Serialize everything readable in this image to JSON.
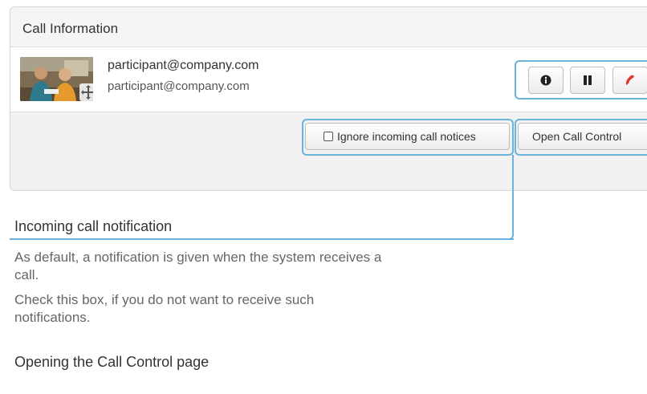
{
  "call_panel": {
    "title": "Call Information",
    "close_label": "×",
    "remote_name": "participant@company.com",
    "remote_number": "participant@company.com",
    "buttons": {
      "info_icon": "info-icon",
      "hold_icon": "pause-icon",
      "end_icon": "hang-up-icon"
    },
    "ignore_checkbox_label": "Ignore incoming call notices",
    "open_call_control_label": "Open Call Control"
  },
  "help": {
    "incoming_heading": "Incoming call notification",
    "incoming_para1": "As default, a notification is given when the system receives a call.",
    "incoming_para2": "Check this box, if you do not want to receive such notifications.",
    "opening_heading": "Opening the Call Control page"
  },
  "colors": {
    "callout": "#6bb2dd",
    "hangup": "#d9372b",
    "panel_bg": "#f1f1f1"
  }
}
